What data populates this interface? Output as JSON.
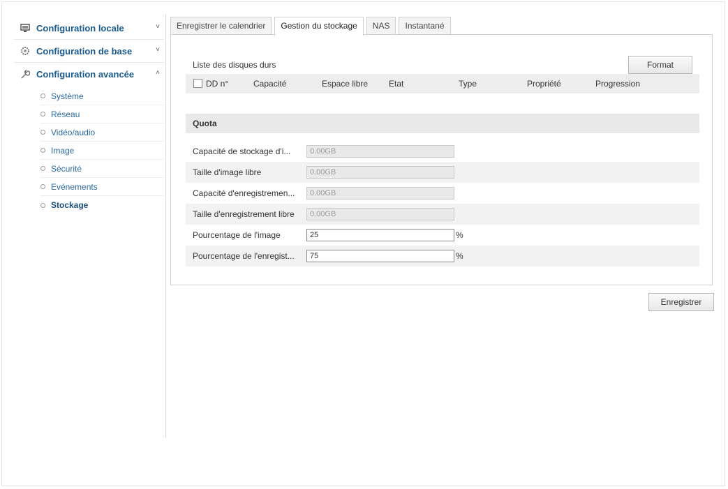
{
  "sidebar": {
    "sections": [
      {
        "label": "Configuration locale",
        "icon": "monitor-icon",
        "chevron": "˅"
      },
      {
        "label": "Configuration de base",
        "icon": "gear-icon",
        "chevron": "˅"
      },
      {
        "label": "Configuration avancée",
        "icon": "wrench-icon",
        "chevron": "˄"
      }
    ],
    "items": [
      {
        "label": "Système"
      },
      {
        "label": "Réseau"
      },
      {
        "label": "Vidéo/audio"
      },
      {
        "label": "Image"
      },
      {
        "label": "Sécurité"
      },
      {
        "label": "Evénements"
      },
      {
        "label": "Stockage"
      }
    ],
    "active_item": "Stockage"
  },
  "tabs": [
    {
      "label": "Enregistrer le calendrier"
    },
    {
      "label": "Gestion du stockage"
    },
    {
      "label": "NAS"
    },
    {
      "label": "Instantané"
    }
  ],
  "active_tab": "Gestion du stockage",
  "hdd": {
    "title": "Liste des disques durs",
    "format_label": "Format",
    "columns": [
      "DD n°",
      "Capacité",
      "Espace libre",
      "Etat",
      "Type",
      "Propriété",
      "Progression"
    ]
  },
  "quota": {
    "title": "Quota",
    "fields": [
      {
        "label": "Capacité de stockage d'i...",
        "value": "0.00GB",
        "unit": ""
      },
      {
        "label": "Taille d'image libre",
        "value": "0.00GB",
        "unit": ""
      },
      {
        "label": "Capacité d'enregistremen...",
        "value": "0.00GB",
        "unit": ""
      },
      {
        "label": "Taille d'enregistrement libre",
        "value": "0.00GB",
        "unit": ""
      },
      {
        "label": "Pourcentage de l'image",
        "value": "25",
        "unit": "%"
      },
      {
        "label": "Pourcentage de l'enregist...",
        "value": "75",
        "unit": "%"
      }
    ]
  },
  "save_label": "Enregistrer"
}
